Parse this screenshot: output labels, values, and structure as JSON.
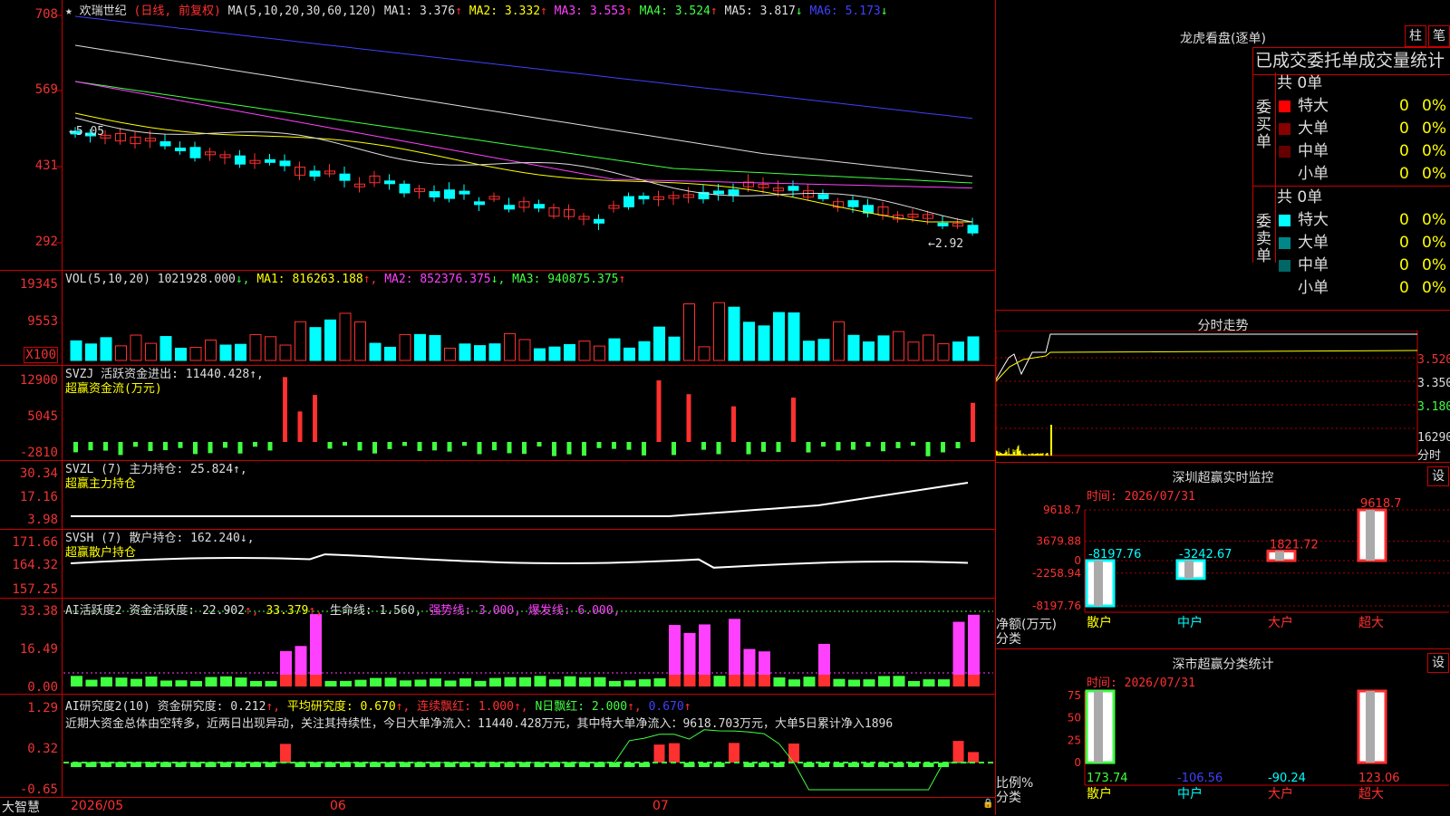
{
  "stock": {
    "star": "★",
    "name": "欢瑞世纪",
    "mode": "(日线, 前复权)"
  },
  "ma_header": [
    {
      "label": "MA(5,10,20,30,60,120)",
      "color": "#dddddd"
    },
    {
      "label": "MA1: 3.376",
      "arrow": "↑",
      "color": "#dddddd",
      "acolor": "#ff3030"
    },
    {
      "label": "MA2: 3.332",
      "arrow": "↑",
      "color": "#ffff00",
      "acolor": "#ff3030"
    },
    {
      "label": "MA3: 3.553",
      "arrow": "↑",
      "color": "#ff40ff",
      "acolor": "#ff3030"
    },
    {
      "label": "MA4: 3.524",
      "arrow": "↑",
      "color": "#40ff40",
      "acolor": "#ff3030"
    },
    {
      "label": "MA5: 3.817",
      "arrow": "↓",
      "color": "#dddddd",
      "acolor": "#40ff40"
    },
    {
      "label": "MA6: 5.173",
      "arrow": "↓",
      "color": "#4040ff",
      "acolor": "#40ff40"
    }
  ],
  "price_axis": [
    "708",
    "569",
    "431",
    "292"
  ],
  "price_annotations": {
    "high": "5.05",
    "low": "2.92"
  },
  "vol_header": {
    "label": "VOL(5,10,20)",
    "value": "1021928.000",
    "ma1": "MA1: 816263.188",
    "ma2": "MA2: 852376.375",
    "ma3": "MA3: 940875.375"
  },
  "vol_axis": [
    "19345",
    "9553",
    "X100"
  ],
  "svzj": {
    "line1": "SVZJ  活跃资金进出: 11440.428↑,",
    "line2": "超赢资金流(万元)",
    "axis": [
      "12900",
      "5045",
      "-2810"
    ]
  },
  "svzl": {
    "line1": "SVZL (7) 主力持仓: 25.824↑,",
    "line2": "超赢主力持仓",
    "axis": [
      "30.34",
      "17.16",
      "3.98"
    ]
  },
  "svsh": {
    "line1": "SVSH (7) 散户持仓: 162.240↓,",
    "line2": "超赢散户持仓",
    "axis": [
      "171.66",
      "164.32",
      "157.25"
    ]
  },
  "ai1": {
    "segments": [
      {
        "t": "AI活跃度2 资金活跃度: 22.902",
        "c": "#dddddd"
      },
      {
        "t": "↑, ",
        "c": "#ff3030"
      },
      {
        "t": "33.379",
        "c": "#ffff00"
      },
      {
        "t": "↑, ",
        "c": "#ff3030"
      },
      {
        "t": "生命线: 1.560, ",
        "c": "#dddddd"
      },
      {
        "t": "强势线: 3.000, ",
        "c": "#ff40ff"
      },
      {
        "t": "爆发线: 6.000,",
        "c": "#ff40ff"
      }
    ],
    "axis": [
      "33.38",
      "16.49",
      "0.00"
    ]
  },
  "ai2": {
    "segments": [
      {
        "t": "AI研究度2(10) 资金研究度: 0.212",
        "c": "#dddddd"
      },
      {
        "t": "↑, ",
        "c": "#ff3030"
      },
      {
        "t": "平均研究度: 0.670",
        "c": "#ffff00"
      },
      {
        "t": "↑, ",
        "c": "#ff3030"
      },
      {
        "t": "连续飘红: 1.000",
        "c": "#ff3030"
      },
      {
        "t": "↑, ",
        "c": "#ff3030"
      },
      {
        "t": "N日飘红: 2.000",
        "c": "#40ff40"
      },
      {
        "t": "↑, ",
        "c": "#ff3030"
      },
      {
        "t": "0.670",
        "c": "#4040ff"
      },
      {
        "t": "↑",
        "c": "#ff3030"
      }
    ],
    "comment": "近期大资金总体由空转多，近两日出现异动，关注其持续性，今日大单净流入：11440.428万元，其中特大单净流入：9618.703万元，大单5日累计净入1896",
    "axis": [
      "1.29",
      "0.32",
      "-0.65"
    ]
  },
  "date_axis": {
    "brand": "大智慧",
    "labels": [
      "2026/05",
      "06",
      "07"
    ]
  },
  "lhb": {
    "title": "龙虎看盘(逐单)",
    "btn_zhu": "柱",
    "btn_bi": "笔",
    "header": "已成交委托单成交量统计",
    "buy": {
      "side_label": "委买单",
      "total": "共 0单",
      "rows": [
        {
          "name": "特大",
          "count": "0",
          "pct": "0%",
          "color": "#ff0000"
        },
        {
          "name": "大单",
          "count": "0",
          "pct": "0%",
          "color": "#880000"
        },
        {
          "name": "中单",
          "count": "0",
          "pct": "0%",
          "color": "#660000"
        },
        {
          "name": "小单",
          "count": "0",
          "pct": "0%",
          "color": "#000000"
        }
      ]
    },
    "sell": {
      "side_label": "委卖单",
      "total": "共 0单",
      "rows": [
        {
          "name": "特大",
          "count": "0",
          "pct": "0%",
          "color": "#00ffff"
        },
        {
          "name": "大单",
          "count": "0",
          "pct": "0%",
          "color": "#008888"
        },
        {
          "name": "中单",
          "count": "0",
          "pct": "0%",
          "color": "#006666"
        },
        {
          "name": "小单",
          "count": "0",
          "pct": "0%",
          "color": "#000000"
        }
      ]
    }
  },
  "intraday": {
    "title": "分时走势",
    "axis": [
      "3.520",
      "3.350",
      "3.180"
    ],
    "vol": "16290",
    "vol_unit": "分时"
  },
  "sz_monitor": {
    "title": "深圳超赢实时监控",
    "btn": "设",
    "time": "时间: 2026/07/31",
    "axis": [
      "9618.7",
      "3679.88",
      "0",
      "-2258.94",
      "-8197.76"
    ],
    "ylabel": "净额(万元)",
    "xlabel": "分类",
    "chart_data": {
      "type": "bar",
      "categories": [
        "散户",
        "中户",
        "大户",
        "超大"
      ],
      "values": [
        -8197.76,
        -3242.67,
        1821.72,
        9618.7
      ],
      "ylim": [
        -8197.76,
        9618.7
      ]
    },
    "value_labels": [
      "-8197.76",
      "-3242.67",
      "1821.72",
      "9618.7"
    ]
  },
  "sz_class": {
    "title": "深市超赢分类统计",
    "btn": "设",
    "time": "时间: 2026/07/31",
    "axis": [
      "75",
      "50",
      "25",
      "0"
    ],
    "ylabel": "比例%",
    "xlabel": "分类",
    "chart_data": {
      "type": "bar",
      "categories": [
        "散户",
        "中户",
        "大户",
        "超大"
      ],
      "values": [
        173.74,
        -106.56,
        -90.24,
        123.06
      ],
      "ylim": [
        0,
        100
      ]
    },
    "value_labels": [
      "173.74",
      "-106.56",
      "-90.24",
      "123.06"
    ]
  },
  "colors": {
    "up": "#ff3030",
    "down": "#00ffff",
    "grid": "#aa0000",
    "frame": "#cc0000"
  }
}
